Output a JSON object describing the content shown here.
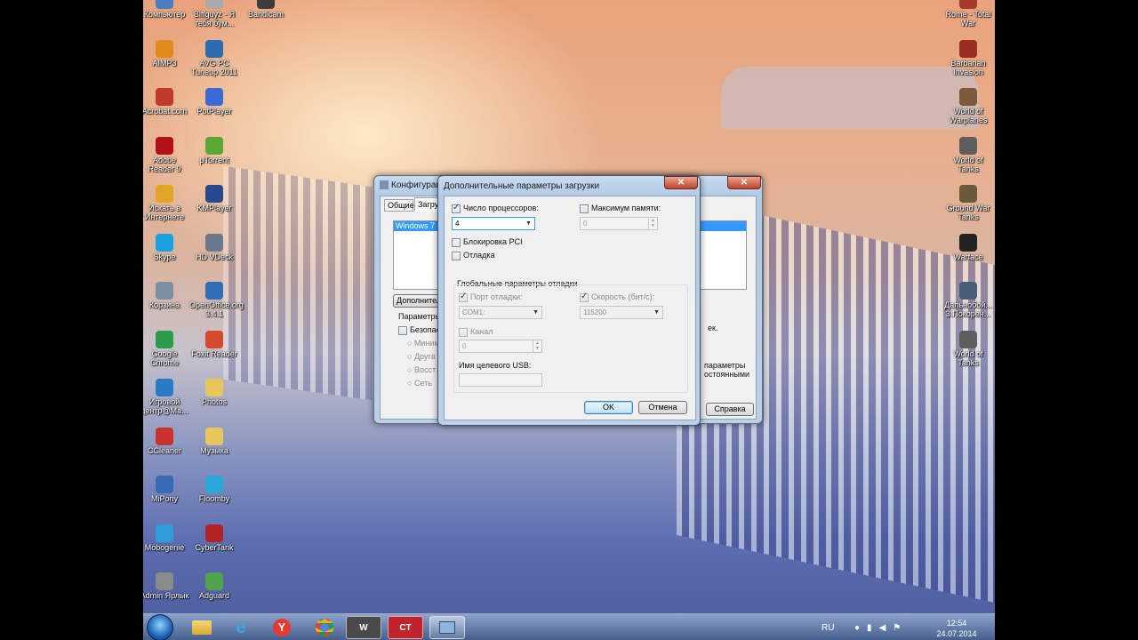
{
  "desktop": {
    "icons_left": [
      {
        "label": "Компьютер",
        "icon": "computer-icon",
        "color": "#4a7fc1"
      },
      {
        "label": "AIMP3",
        "icon": "aimp-icon",
        "color": "#e28a1c"
      },
      {
        "label": "Acrobat.com",
        "icon": "acrobat-icon",
        "color": "#c0392b"
      },
      {
        "label": "Adobe Reader 9",
        "icon": "adobe-reader-icon",
        "color": "#b3111a"
      },
      {
        "label": "Искать в Интернете",
        "icon": "search-web-icon",
        "color": "#e0a526"
      },
      {
        "label": "Skype",
        "icon": "skype-icon",
        "color": "#1aa1e1"
      },
      {
        "label": "Корзина",
        "icon": "recycle-bin-icon",
        "color": "#7f8fa3"
      },
      {
        "label": "Google Chrome",
        "icon": "chrome-icon",
        "color": "#2c9c4a"
      },
      {
        "label": "Игровой центр@Ma...",
        "icon": "game-center-icon",
        "color": "#2a7ac7"
      },
      {
        "label": "CCleaner",
        "icon": "ccleaner-icon",
        "color": "#c9332b"
      },
      {
        "label": "MiPony",
        "icon": "mipony-icon",
        "color": "#3a6bb5"
      },
      {
        "label": "Mobogenie",
        "icon": "mobogenie-icon",
        "color": "#2d9fd8"
      },
      {
        "label": "Admin Ярлык",
        "icon": "admin-shortcut-icon",
        "color": "#8a8a8a"
      }
    ],
    "icons_mid": [
      {
        "label": "Biffguyz - Я тебя бум...",
        "icon": "folder-icon",
        "color": "#a9a9a9"
      },
      {
        "label": "AVG PC Tuneup 2011",
        "icon": "avg-icon",
        "color": "#2c6db2"
      },
      {
        "label": "PotPlayer",
        "icon": "potplayer-icon",
        "color": "#3a6ad4"
      },
      {
        "label": "μTorrent",
        "icon": "utorrent-icon",
        "color": "#5aa833"
      },
      {
        "label": "KMPlayer",
        "icon": "kmplayer-icon",
        "color": "#264a8c"
      },
      {
        "label": "HD VDeck",
        "icon": "hd-vdeck-icon",
        "color": "#6a7a8c"
      },
      {
        "label": "OpenOffice.org 3.4.1",
        "icon": "openoffice-icon",
        "color": "#2f6db5"
      },
      {
        "label": "Foxit Reader",
        "icon": "foxit-icon",
        "color": "#d14a2b"
      },
      {
        "label": "Photos",
        "icon": "folder-icon",
        "color": "#e8c659"
      },
      {
        "label": "Музыка",
        "icon": "folder-icon",
        "color": "#e8c659"
      },
      {
        "label": "Floomby",
        "icon": "floomby-icon",
        "color": "#2ba8d8"
      },
      {
        "label": "CyberTank",
        "icon": "cybertank-icon",
        "color": "#b02424"
      },
      {
        "label": "Adguard",
        "icon": "adguard-icon",
        "color": "#4fa34a"
      }
    ],
    "icons_right": [
      {
        "label": "Rome - Total War",
        "icon": "rome-icon",
        "color": "#a33b2b"
      },
      {
        "label": "Barbarian Invasion",
        "icon": "barbarian-icon",
        "color": "#9c2d21"
      },
      {
        "label": "World of Warplanes",
        "icon": "warplanes-icon",
        "color": "#7c5a3a"
      },
      {
        "label": "World of Tanks",
        "icon": "tanks-icon",
        "color": "#5e5e5e"
      },
      {
        "label": "Ground War Tanks",
        "icon": "ground-war-icon",
        "color": "#6a5a3a"
      },
      {
        "label": "Warface",
        "icon": "warface-icon",
        "color": "#222222"
      },
      {
        "label": "Дальнобой... 3.Покорен...",
        "icon": "truck-game-icon",
        "color": "#4a5e7a"
      },
      {
        "label": "World of Tanks",
        "icon": "tanks-icon",
        "color": "#5e5e5e"
      }
    ],
    "bandicam": {
      "label": "Bandicam",
      "icon": "bandicam-icon",
      "color": "#3d3d3d"
    }
  },
  "back_window": {
    "title": "Конфигурац",
    "tabs": [
      "Общие",
      "Загру"
    ],
    "list_item": "Windows 7 (C",
    "advanced_button": "Дополнител",
    "params_label": "Параметры",
    "safe_mode": "Безопас",
    "options": [
      "Миним",
      "Друга",
      "Восст",
      "Сеть"
    ],
    "right_text_1": "ек.",
    "right_text_2": "параметры",
    "right_text_3": "остоянными",
    "help_button": "Справка"
  },
  "dialog": {
    "title": "Дополнительные параметры загрузки",
    "num_processors_label": "Число процессоров:",
    "num_processors_checked": true,
    "num_processors_value": "4",
    "max_memory_label": "Максимум памяти:",
    "max_memory_value": "0",
    "pci_lock_label": "Блокировка PCI",
    "debug_label": "Отладка",
    "global_debug_label": "Глобальные параметры отладки",
    "debug_port_label": "Порт отладки:",
    "debug_port_value": "COM1:",
    "baud_rate_label": "Скорость (бит/с):",
    "baud_rate_value": "115200",
    "channel_label": "Канал",
    "channel_value": "0",
    "usb_target_label": "Имя целевого USB:",
    "ok_label": "OK",
    "cancel_label": "Отмена"
  },
  "taskbar": {
    "language": "RU",
    "time": "12:54",
    "date": "24.07.2014"
  }
}
